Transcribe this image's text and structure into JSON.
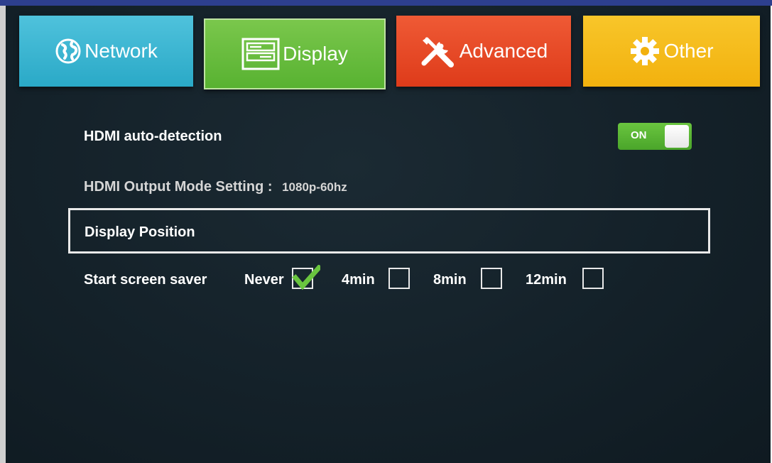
{
  "tabs": [
    {
      "label": "Network",
      "icon": "globe-icon",
      "color": "#2aa9c7"
    },
    {
      "label": "Display",
      "icon": "sliders-icon",
      "color": "#58b231"
    },
    {
      "label": "Advanced",
      "icon": "tools-icon",
      "color": "#de3b1a"
    },
    {
      "label": "Other",
      "icon": "gear-icon",
      "color": "#f2b10e"
    }
  ],
  "selected_tab": "Display",
  "hdmi_auto": {
    "label": "HDMI auto-detection",
    "toggle_text": "ON",
    "state": true
  },
  "hdmi_output": {
    "label": "HDMI Output Mode Setting :",
    "value": "1080p-60hz"
  },
  "display_position": {
    "label": "Display Position"
  },
  "screensaver": {
    "label": "Start screen saver",
    "options": [
      {
        "label": "Never",
        "checked": true
      },
      {
        "label": "4min",
        "checked": false
      },
      {
        "label": "8min",
        "checked": false
      },
      {
        "label": "12min",
        "checked": false
      }
    ]
  },
  "colors": {
    "check": "#6ac53f",
    "panel": "#142129",
    "top_border": "#2d3f8e"
  }
}
